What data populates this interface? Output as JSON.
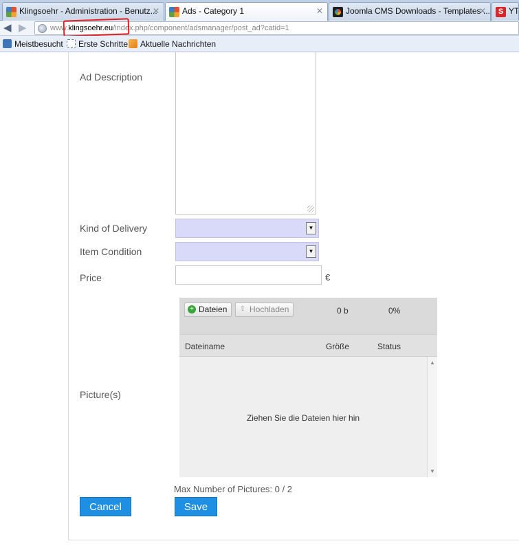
{
  "browser": {
    "tabs": [
      {
        "title": "Klingsoehr - Administration - Benutz...",
        "favicon": "joomla-icon"
      },
      {
        "title": "Ads - Category 1",
        "favicon": "joomla-icon"
      },
      {
        "title": "Joomla CMS Downloads - Templates ...",
        "favicon": "joomla-downloads-icon"
      },
      {
        "title": "YT",
        "favicon": "s-icon"
      }
    ],
    "url_prefix": "www.",
    "url_domain": "klingsoehr.eu",
    "url_path": "/index.php/component/adsmanager/post_ad?catid=1",
    "bookmarks": [
      "Meistbesucht",
      "Erste Schritte",
      "Aktuelle Nachrichten"
    ]
  },
  "form": {
    "description_label": "Ad Description",
    "delivery_label": "Kind of Delivery",
    "condition_label": "Item Condition",
    "price_label": "Price",
    "currency": "€",
    "pictures_label": "Picture(s)"
  },
  "uploader": {
    "add_button": "Dateien",
    "upload_button": "Hochladen",
    "total_size": "0 b",
    "percent": "0%",
    "col_filename": "Dateiname",
    "col_size": "Größe",
    "col_status": "Status",
    "drop_hint": "Ziehen Sie die Dateien hier hin"
  },
  "max_pictures": "Max Number of Pictures: 0 / 2",
  "actions": {
    "cancel": "Cancel",
    "save": "Save"
  },
  "colors": {
    "button_blue": "#1e8fe3",
    "select_bg": "#d9d9f9"
  }
}
